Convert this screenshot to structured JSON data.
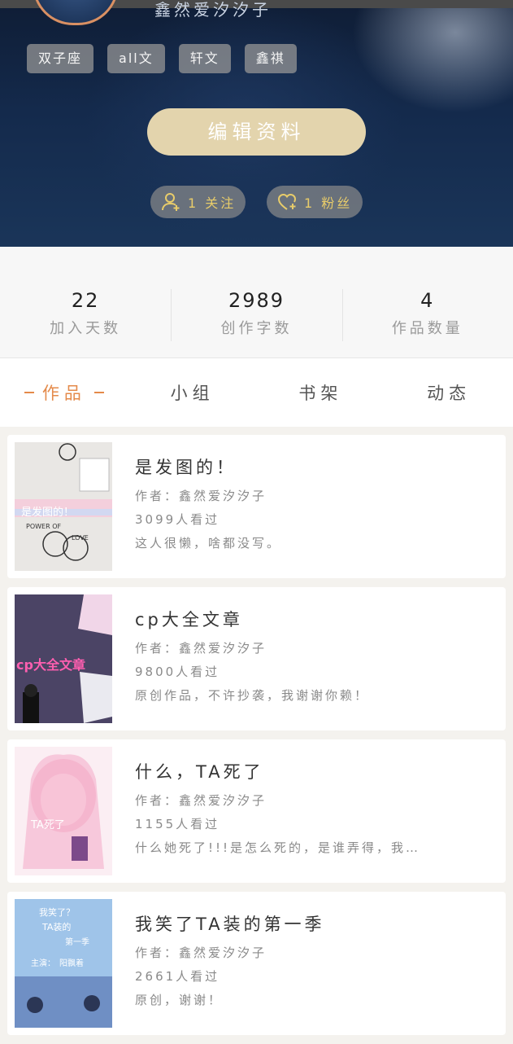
{
  "profile": {
    "username": "鑫然爱汐汐子",
    "tags": [
      "双子座",
      "all文",
      "轩文",
      "鑫祺"
    ],
    "edit_label": "编辑资料",
    "following_label": "1 关注",
    "fans_label": "1 粉丝"
  },
  "stats": [
    {
      "value": "22",
      "label": "加入天数"
    },
    {
      "value": "2989",
      "label": "创作字数"
    },
    {
      "value": "4",
      "label": "作品数量"
    }
  ],
  "tabs": [
    {
      "label": "作品",
      "active": true
    },
    {
      "label": "小组",
      "active": false
    },
    {
      "label": "书架",
      "active": false
    },
    {
      "label": "动态",
      "active": false
    }
  ],
  "works": [
    {
      "title": "是发图的！",
      "author": "作者：鑫然爱汐汐子",
      "views": "3099人看过",
      "desc": "这人很懒，啥都没写。",
      "cover_text": [
        "是发图的！",
        "POWER OF",
        "LOVE"
      ]
    },
    {
      "title": "cp大全文章",
      "author": "作者：鑫然爱汐汐子",
      "views": "9800人看过",
      "desc": "原创作品，不许抄袭，我谢谢你赖！",
      "cover_text": [
        "cp大全文章"
      ]
    },
    {
      "title": "什么，TA死了",
      "author": "作者：鑫然爱汐汐子",
      "views": "1155人看过",
      "desc": "什么她死了!!!是怎么死的，是谁弄得，我…",
      "cover_text": [
        "TA死了"
      ]
    },
    {
      "title": "我笑了TA装的第一季",
      "author": "作者：鑫然爱汐汐子",
      "views": "2661人看过",
      "desc": "原创，谢谢！",
      "cover_text": [
        "我笑了？",
        "TA装的",
        "第一季",
        "主演：",
        "阳飘着"
      ]
    }
  ],
  "colors": {
    "accent": "#e48a4a",
    "edit_button": "#e3d4ad",
    "pill_text": "#e8cc6a"
  }
}
